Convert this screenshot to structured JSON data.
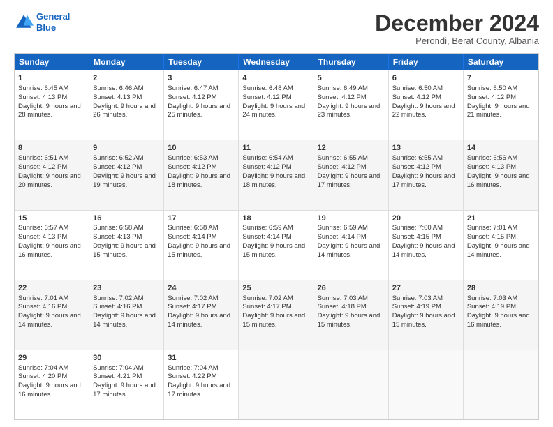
{
  "logo": {
    "line1": "General",
    "line2": "Blue"
  },
  "title": "December 2024",
  "location": "Perondi, Berat County, Albania",
  "days_of_week": [
    "Sunday",
    "Monday",
    "Tuesday",
    "Wednesday",
    "Thursday",
    "Friday",
    "Saturday"
  ],
  "weeks": [
    [
      {
        "day": "1",
        "sunrise": "Sunrise: 6:45 AM",
        "sunset": "Sunset: 4:13 PM",
        "daylight": "Daylight: 9 hours and 28 minutes."
      },
      {
        "day": "2",
        "sunrise": "Sunrise: 6:46 AM",
        "sunset": "Sunset: 4:13 PM",
        "daylight": "Daylight: 9 hours and 26 minutes."
      },
      {
        "day": "3",
        "sunrise": "Sunrise: 6:47 AM",
        "sunset": "Sunset: 4:12 PM",
        "daylight": "Daylight: 9 hours and 25 minutes."
      },
      {
        "day": "4",
        "sunrise": "Sunrise: 6:48 AM",
        "sunset": "Sunset: 4:12 PM",
        "daylight": "Daylight: 9 hours and 24 minutes."
      },
      {
        "day": "5",
        "sunrise": "Sunrise: 6:49 AM",
        "sunset": "Sunset: 4:12 PM",
        "daylight": "Daylight: 9 hours and 23 minutes."
      },
      {
        "day": "6",
        "sunrise": "Sunrise: 6:50 AM",
        "sunset": "Sunset: 4:12 PM",
        "daylight": "Daylight: 9 hours and 22 minutes."
      },
      {
        "day": "7",
        "sunrise": "Sunrise: 6:50 AM",
        "sunset": "Sunset: 4:12 PM",
        "daylight": "Daylight: 9 hours and 21 minutes."
      }
    ],
    [
      {
        "day": "8",
        "sunrise": "Sunrise: 6:51 AM",
        "sunset": "Sunset: 4:12 PM",
        "daylight": "Daylight: 9 hours and 20 minutes."
      },
      {
        "day": "9",
        "sunrise": "Sunrise: 6:52 AM",
        "sunset": "Sunset: 4:12 PM",
        "daylight": "Daylight: 9 hours and 19 minutes."
      },
      {
        "day": "10",
        "sunrise": "Sunrise: 6:53 AM",
        "sunset": "Sunset: 4:12 PM",
        "daylight": "Daylight: 9 hours and 18 minutes."
      },
      {
        "day": "11",
        "sunrise": "Sunrise: 6:54 AM",
        "sunset": "Sunset: 4:12 PM",
        "daylight": "Daylight: 9 hours and 18 minutes."
      },
      {
        "day": "12",
        "sunrise": "Sunrise: 6:55 AM",
        "sunset": "Sunset: 4:12 PM",
        "daylight": "Daylight: 9 hours and 17 minutes."
      },
      {
        "day": "13",
        "sunrise": "Sunrise: 6:55 AM",
        "sunset": "Sunset: 4:12 PM",
        "daylight": "Daylight: 9 hours and 17 minutes."
      },
      {
        "day": "14",
        "sunrise": "Sunrise: 6:56 AM",
        "sunset": "Sunset: 4:13 PM",
        "daylight": "Daylight: 9 hours and 16 minutes."
      }
    ],
    [
      {
        "day": "15",
        "sunrise": "Sunrise: 6:57 AM",
        "sunset": "Sunset: 4:13 PM",
        "daylight": "Daylight: 9 hours and 16 minutes."
      },
      {
        "day": "16",
        "sunrise": "Sunrise: 6:58 AM",
        "sunset": "Sunset: 4:13 PM",
        "daylight": "Daylight: 9 hours and 15 minutes."
      },
      {
        "day": "17",
        "sunrise": "Sunrise: 6:58 AM",
        "sunset": "Sunset: 4:14 PM",
        "daylight": "Daylight: 9 hours and 15 minutes."
      },
      {
        "day": "18",
        "sunrise": "Sunrise: 6:59 AM",
        "sunset": "Sunset: 4:14 PM",
        "daylight": "Daylight: 9 hours and 15 minutes."
      },
      {
        "day": "19",
        "sunrise": "Sunrise: 6:59 AM",
        "sunset": "Sunset: 4:14 PM",
        "daylight": "Daylight: 9 hours and 14 minutes."
      },
      {
        "day": "20",
        "sunrise": "Sunrise: 7:00 AM",
        "sunset": "Sunset: 4:15 PM",
        "daylight": "Daylight: 9 hours and 14 minutes."
      },
      {
        "day": "21",
        "sunrise": "Sunrise: 7:01 AM",
        "sunset": "Sunset: 4:15 PM",
        "daylight": "Daylight: 9 hours and 14 minutes."
      }
    ],
    [
      {
        "day": "22",
        "sunrise": "Sunrise: 7:01 AM",
        "sunset": "Sunset: 4:16 PM",
        "daylight": "Daylight: 9 hours and 14 minutes."
      },
      {
        "day": "23",
        "sunrise": "Sunrise: 7:02 AM",
        "sunset": "Sunset: 4:16 PM",
        "daylight": "Daylight: 9 hours and 14 minutes."
      },
      {
        "day": "24",
        "sunrise": "Sunrise: 7:02 AM",
        "sunset": "Sunset: 4:17 PM",
        "daylight": "Daylight: 9 hours and 14 minutes."
      },
      {
        "day": "25",
        "sunrise": "Sunrise: 7:02 AM",
        "sunset": "Sunset: 4:17 PM",
        "daylight": "Daylight: 9 hours and 15 minutes."
      },
      {
        "day": "26",
        "sunrise": "Sunrise: 7:03 AM",
        "sunset": "Sunset: 4:18 PM",
        "daylight": "Daylight: 9 hours and 15 minutes."
      },
      {
        "day": "27",
        "sunrise": "Sunrise: 7:03 AM",
        "sunset": "Sunset: 4:19 PM",
        "daylight": "Daylight: 9 hours and 15 minutes."
      },
      {
        "day": "28",
        "sunrise": "Sunrise: 7:03 AM",
        "sunset": "Sunset: 4:19 PM",
        "daylight": "Daylight: 9 hours and 16 minutes."
      }
    ],
    [
      {
        "day": "29",
        "sunrise": "Sunrise: 7:04 AM",
        "sunset": "Sunset: 4:20 PM",
        "daylight": "Daylight: 9 hours and 16 minutes."
      },
      {
        "day": "30",
        "sunrise": "Sunrise: 7:04 AM",
        "sunset": "Sunset: 4:21 PM",
        "daylight": "Daylight: 9 hours and 17 minutes."
      },
      {
        "day": "31",
        "sunrise": "Sunrise: 7:04 AM",
        "sunset": "Sunset: 4:22 PM",
        "daylight": "Daylight: 9 hours and 17 minutes."
      },
      {
        "day": "",
        "sunrise": "",
        "sunset": "",
        "daylight": ""
      },
      {
        "day": "",
        "sunrise": "",
        "sunset": "",
        "daylight": ""
      },
      {
        "day": "",
        "sunrise": "",
        "sunset": "",
        "daylight": ""
      },
      {
        "day": "",
        "sunrise": "",
        "sunset": "",
        "daylight": ""
      }
    ]
  ]
}
